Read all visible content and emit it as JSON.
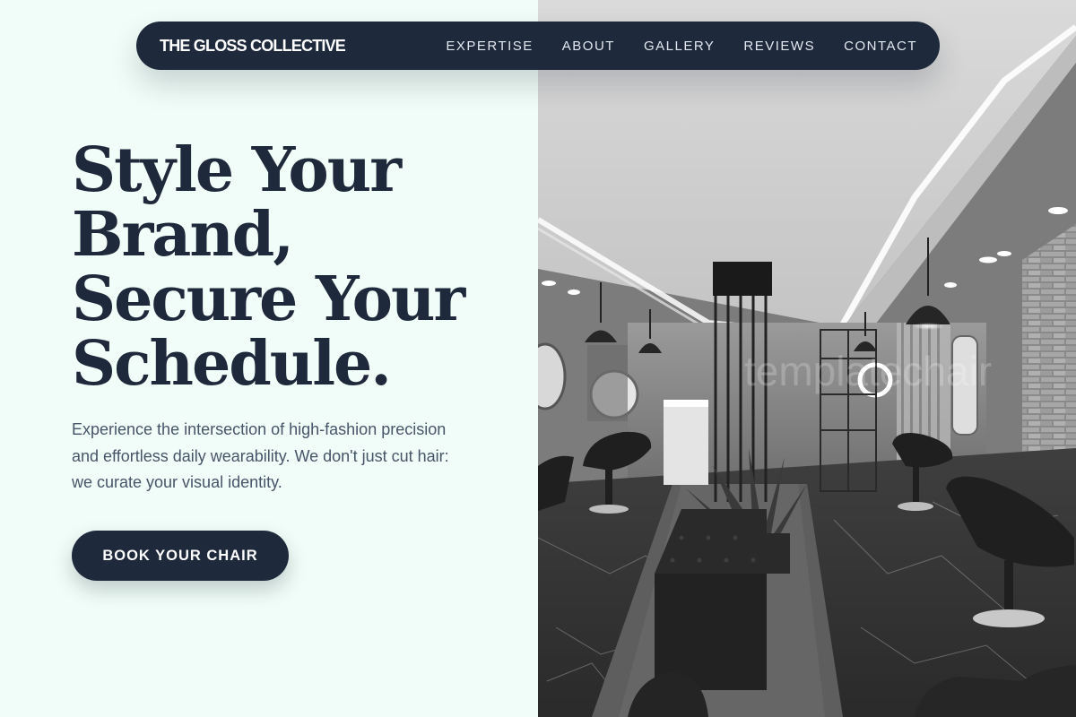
{
  "header": {
    "brand": "THE GLOSS COLLECTIVE",
    "nav": [
      "EXPERTISE",
      "ABOUT",
      "GALLERY",
      "REVIEWS",
      "CONTACT"
    ]
  },
  "hero": {
    "title_lines": [
      "Style Your",
      "Brand,",
      "Secure Your",
      "Schedule."
    ],
    "description": "Experience the intersection of high-fashion precision and effortless daily wearability. We don't just cut hair: we curate your visual identity.",
    "cta_label": "BOOK YOUR CHAIR"
  },
  "image": {
    "subject": "black-and-white salon interior",
    "icon": "salon-interior-photo"
  },
  "colors": {
    "navy": "#1e293b",
    "background": "#f1fdf8",
    "body_text": "#475569",
    "nav_text": "#e2e8f0"
  }
}
